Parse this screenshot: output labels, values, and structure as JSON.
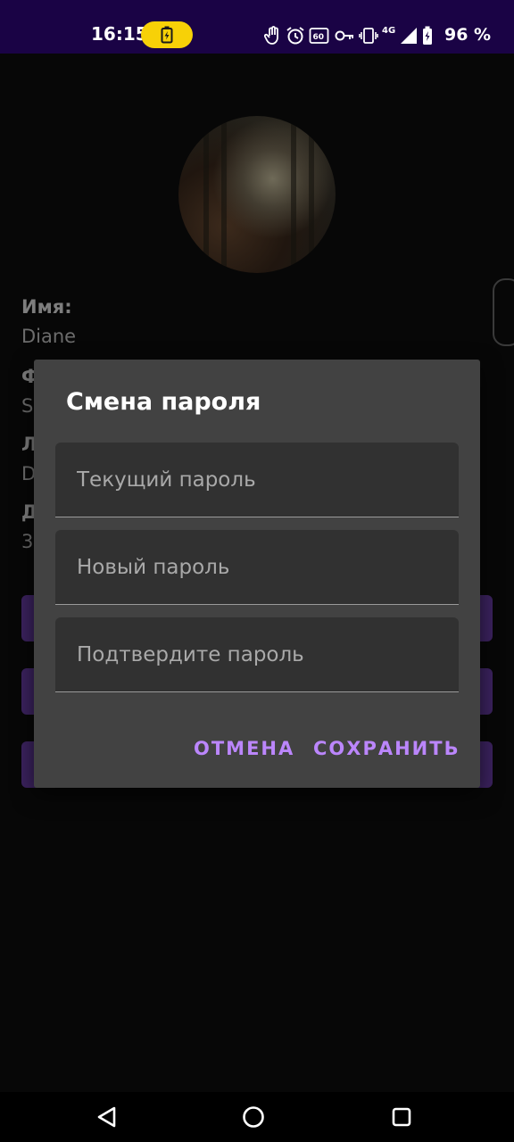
{
  "status_bar": {
    "time": "16:15",
    "battery_percent": "96 %",
    "network": "4G",
    "icons": [
      "battery-charging-icon",
      "hand-icon",
      "alarm-icon",
      "refresh-60-icon",
      "key-icon",
      "vibrate-icon",
      "signal-icon",
      "battery-icon"
    ]
  },
  "profile": {
    "name_label": "Имя:",
    "name_value": "Diane",
    "partial_labels": [
      "Ф",
      "Л",
      "Д"
    ],
    "partial_values": [
      "S",
      "D",
      "3"
    ]
  },
  "dialog": {
    "title": "Смена пароля",
    "fields": [
      {
        "placeholder": "Текущий пароль",
        "value": ""
      },
      {
        "placeholder": "Новый пароль",
        "value": ""
      },
      {
        "placeholder": "Подтвердите пароль",
        "value": ""
      }
    ],
    "cancel_label": "ОТМЕНА",
    "save_label": "СОХРАНИТЬ"
  },
  "colors": {
    "accent": "#bb86fc",
    "status_bar": "#1a0345",
    "dialog_bg": "#424242",
    "battery_pill": "#f7d107"
  },
  "navigation": {
    "icons": [
      "back-icon",
      "home-icon",
      "recents-icon"
    ]
  }
}
